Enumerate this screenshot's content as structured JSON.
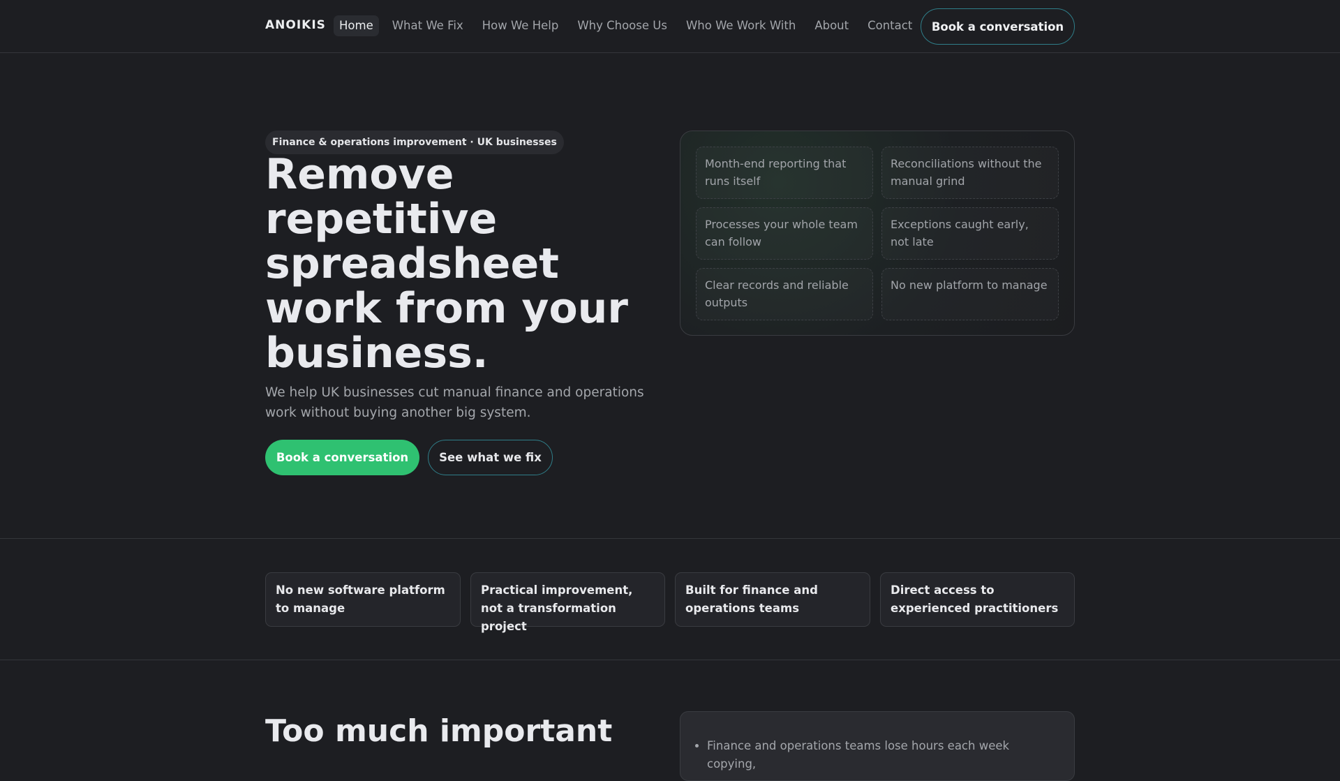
{
  "nav": {
    "logo": "ANOIKIS",
    "links": [
      "Home",
      "What We Fix",
      "How We Help",
      "Why Choose Us",
      "Who We Work With",
      "About",
      "Contact"
    ],
    "cta": "Book a conversation"
  },
  "hero": {
    "badge": "Finance & operations improvement · UK businesses",
    "title": "Remove repetitive spreadsheet work from your business.",
    "subtitle": "We help UK businesses cut manual finance and operations work without buying another big system.",
    "primary_button": "Book a conversation",
    "secondary_button": "See what we fix",
    "panel_items": [
      "Month-end reporting that runs itself",
      "Reconciliations without the manual grind",
      "Processes your whole team can follow",
      "Exceptions caught early, not late",
      "Clear records and reliable outputs",
      "No new platform to manage"
    ]
  },
  "features": [
    "No new software platform to manage",
    "Practical improvement, not a transformation project",
    "Built for finance and operations teams",
    "Direct access to experienced practitioners"
  ],
  "problem": {
    "heading": "Too much important",
    "bullets": [
      "Finance and operations teams lose hours each week copying,"
    ]
  },
  "colors": {
    "accent": "#2fc171",
    "outline": "#2f7e89",
    "background": "#1d1e22"
  }
}
